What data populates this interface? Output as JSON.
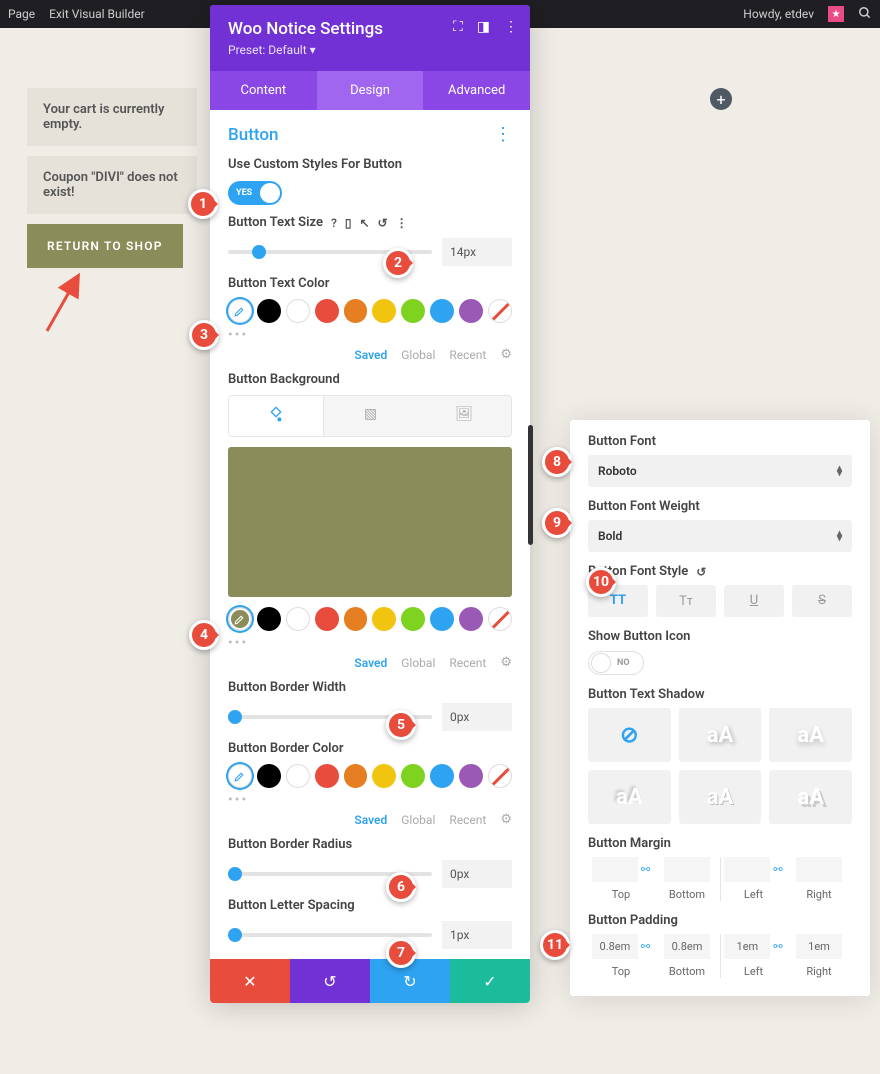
{
  "topbar": {
    "page": "Page",
    "exit": "Exit Visual Builder",
    "howdy": "Howdy, etdev"
  },
  "pg": {
    "cart_empty": "Your cart is currently empty.",
    "coupon": "Coupon \"DIVI\" does not exist!",
    "return": "RETURN TO SHOP"
  },
  "panel": {
    "title": "Woo Notice Settings",
    "preset": "Preset: Default",
    "tabs": {
      "content": "Content",
      "design": "Design",
      "advanced": "Advanced"
    },
    "section": "Button",
    "custom_styles_lbl": "Use Custom Styles For Button",
    "yes": "YES",
    "text_size_lbl": "Button Text Size",
    "text_size_val": "14px",
    "text_color_lbl": "Button Text Color",
    "bg_lbl": "Button Background",
    "border_w_lbl": "Button Border Width",
    "border_w_val": "0px",
    "border_c_lbl": "Button Border Color",
    "border_r_lbl": "Button Border Radius",
    "border_r_val": "0px",
    "letter_lbl": "Button Letter Spacing",
    "letter_val": "1px",
    "swatch_tabs": {
      "saved": "Saved",
      "global": "Global",
      "recent": "Recent"
    },
    "colors": {
      "black": "#000000",
      "white": "#ffffff",
      "red": "#e74c3c",
      "orange": "#e67e22",
      "yellow": "#f1c40f",
      "green": "#7ed321",
      "blue": "#2ea3f2",
      "purple": "#9b59b6",
      "olive": "#8a8d59"
    }
  },
  "rp": {
    "font_lbl": "Button Font",
    "font_val": "Roboto",
    "weight_lbl": "Button Font Weight",
    "weight_val": "Bold",
    "style_lbl": "Button Font Style",
    "icon_lbl": "Show Button Icon",
    "icon_val": "NO",
    "shadow_lbl": "Button Text Shadow",
    "margin_lbl": "Button Margin",
    "padding_lbl": "Button Padding",
    "sides": {
      "top": "Top",
      "bottom": "Bottom",
      "left": "Left",
      "right": "Right"
    },
    "pad": {
      "top": "0.8em",
      "bottom": "0.8em",
      "left": "1em",
      "right": "1em"
    }
  },
  "markers": {
    "1": "1",
    "2": "2",
    "3": "3",
    "4": "4",
    "5": "5",
    "6": "6",
    "7": "7",
    "8": "8",
    "9": "9",
    "10": "10",
    "11": "11"
  },
  "st": {
    "tt": "TT",
    "tc": "Tᴛ",
    "u": "U",
    "s": "S",
    "aa": "aA"
  }
}
